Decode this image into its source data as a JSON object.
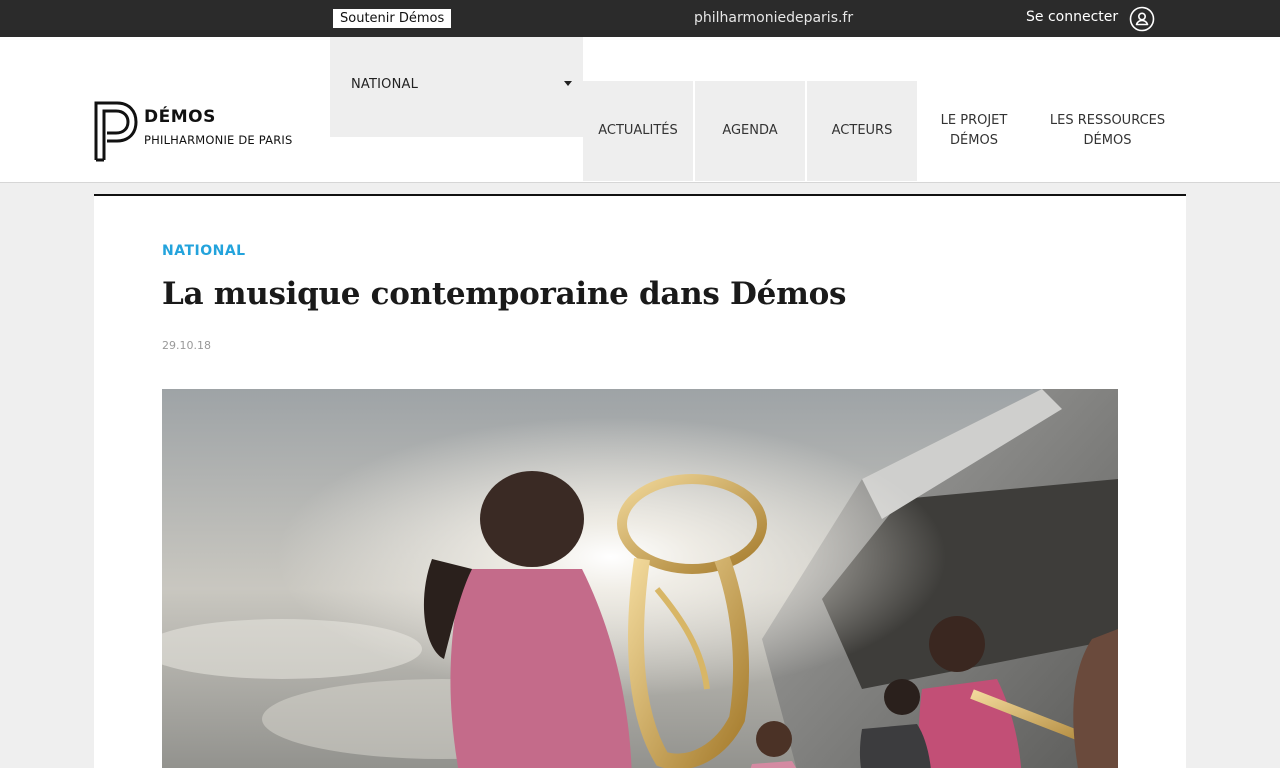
{
  "topbar": {
    "support_label": "Soutenir Démos",
    "site_link": "philharmoniedeparis.fr",
    "login_label": "Se connecter",
    "user_icon": "user-circle-icon"
  },
  "logo": {
    "title": "DÉMOS",
    "subtitle": "PHILHARMONIE DE PARIS"
  },
  "region": {
    "selected": "NATIONAL"
  },
  "nav": {
    "items": [
      {
        "label": "ACTUALITÉS"
      },
      {
        "label": "AGENDA"
      },
      {
        "label": "ACTEURS"
      },
      {
        "label_line1": "LE PROJET",
        "label_line2": "DÉMOS"
      },
      {
        "label_line1": "LES RESSOURCES",
        "label_line2": "DÉMOS"
      }
    ]
  },
  "article": {
    "category": "NATIONAL",
    "title": "La musique contemporaine dans Démos",
    "date": "29.10.18"
  },
  "colors": {
    "topbar_bg": "#2b2b2b",
    "accent": "#23a3dc",
    "nav_grey": "#eeeeee"
  }
}
